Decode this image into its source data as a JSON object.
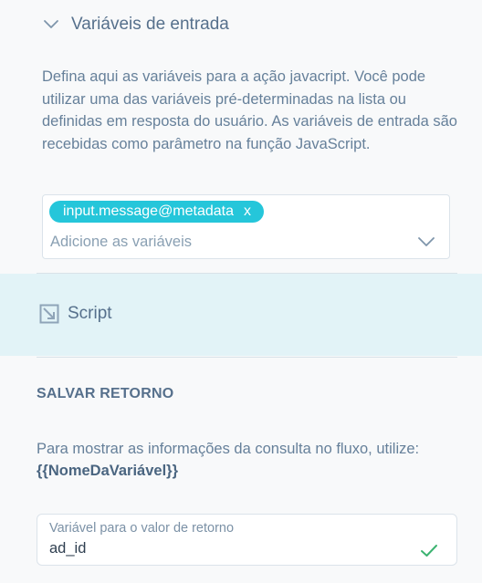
{
  "input_section": {
    "title": "Variáveis de entrada",
    "description": "Defina aqui as variáveis para a ação javacript. Você pode utilizar uma das variáveis pré-determinadas na lista ou definidas em resposta do usuário. As variáveis de entrada são recebidas como parâmetro na função JavaScript.",
    "selected_chip": "input.message@metadata",
    "chip_remove": "x",
    "placeholder": "Adicione as variáveis"
  },
  "script": {
    "label": "Script"
  },
  "save_return": {
    "title": "SALVAR RETORNO",
    "info_text": "Para mostrar as informações da consulta no fluxo, utilize:",
    "info_variable": "{{NomeDaVariável}}",
    "field_label": "Variável para o valor de retorno",
    "field_value": "ad_id"
  },
  "colors": {
    "chip": "#25c6da",
    "script_band": "#e2f3f7",
    "check": "#3cb371"
  }
}
